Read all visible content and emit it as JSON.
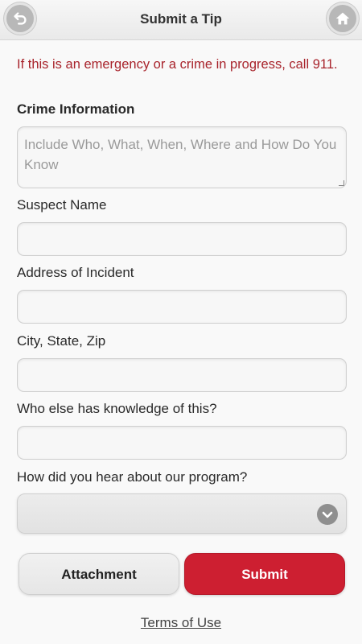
{
  "header": {
    "title": "Submit a Tip",
    "back_icon": "back-arrow-icon",
    "home_icon": "home-icon"
  },
  "form": {
    "warning": "If this is an emergency or a crime in progress, call 911.",
    "crime_info": {
      "label": "Crime Information",
      "placeholder": "Include Who, What, When, Where and How Do You Know",
      "value": ""
    },
    "suspect_name": {
      "label": "Suspect Name",
      "value": ""
    },
    "address": {
      "label": "Address of Incident",
      "value": ""
    },
    "city_state_zip": {
      "label": "City, State, Zip",
      "value": ""
    },
    "others_knowledge": {
      "label": "Who else has knowledge of this?",
      "value": ""
    },
    "heard_about": {
      "label": "How did you hear about our program?",
      "selected": ""
    }
  },
  "actions": {
    "attachment_label": "Attachment",
    "submit_label": "Submit"
  },
  "footer": {
    "terms_label": "Terms of Use"
  },
  "colors": {
    "warning": "#a8232b",
    "submit_bg": "#cd1f31"
  }
}
